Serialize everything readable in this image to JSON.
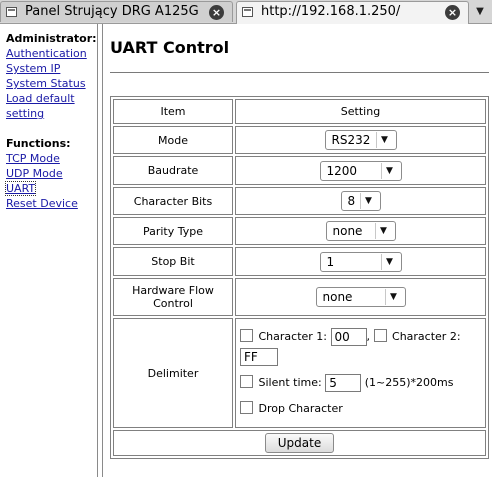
{
  "tabs": [
    {
      "title": "Panel Strujący DRG A125G",
      "close": "×"
    },
    {
      "title": "http://192.168.1.250/",
      "close": "×"
    }
  ],
  "tab_menu": "▼",
  "sidebar": {
    "admin_title": "Administrator:",
    "admin_links": [
      "Authentication",
      "System IP",
      "System Status",
      "Load default",
      "setting"
    ],
    "functions_title": "Functions:",
    "function_links": [
      "TCP Mode",
      "UDP Mode",
      "UART",
      "Reset Device"
    ],
    "active": "UART"
  },
  "main": {
    "title": "UART Control",
    "headers": {
      "item": "Item",
      "setting": "Setting"
    },
    "rows": {
      "mode": {
        "label": "Mode",
        "value": "RS232"
      },
      "baudrate": {
        "label": "Baudrate",
        "value": "1200"
      },
      "charbits": {
        "label": "Character Bits",
        "value": "8"
      },
      "parity": {
        "label": "Parity Type",
        "value": "none"
      },
      "stopbit": {
        "label": "Stop Bit",
        "value": "1"
      },
      "flow": {
        "label1": "Hardware Flow",
        "label2": "Control",
        "value": "none"
      },
      "delimiter": {
        "label": "Delimiter",
        "char1_label": "Character 1:",
        "char1_value": "00",
        "comma": ",",
        "char2_label": "Character 2:",
        "char2_value": "FF",
        "silent_label": "Silent time:",
        "silent_value": "5",
        "silent_hint": "(1~255)*200ms",
        "drop_label": "Drop Character"
      }
    },
    "update_button": "Update"
  }
}
